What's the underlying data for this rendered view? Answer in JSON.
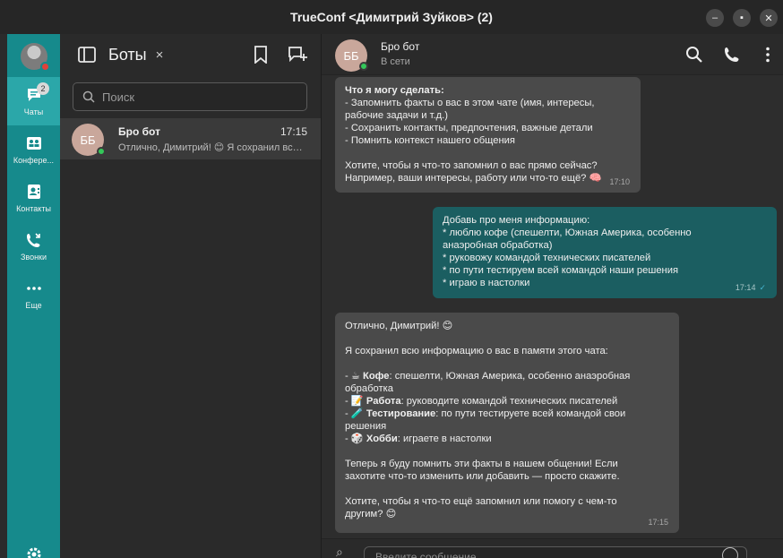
{
  "window": {
    "title": "TrueConf <Димитрий Зуйков> (2)",
    "minimize": "–",
    "maximize": "▪",
    "close": "✕"
  },
  "rail": {
    "chats": {
      "label": "Чаты",
      "badge": "2"
    },
    "conferences": {
      "label": "Конфере..."
    },
    "contacts": {
      "label": "Контакты"
    },
    "calls": {
      "label": "Звонки"
    },
    "more": {
      "label": "Еще"
    }
  },
  "list": {
    "title": "Боты",
    "close": "×",
    "search_placeholder": "Поиск",
    "chats": [
      {
        "initials": "ББ",
        "name": "Бро бот",
        "time": "17:15",
        "preview": "Отлично, Димитрий! 😊 Я сохранил всю информацию"
      }
    ]
  },
  "convo": {
    "initials": "ББ",
    "name": "Бро бот",
    "status": "В сети",
    "composer_placeholder": "Введите сообщение",
    "messages": [
      {
        "lines": [
          "**Что я могу сделать:**",
          "- Запомнить факты о вас в этом чате (имя, интересы,",
          "рабочие задачи и т.д.)",
          "- Сохранить контакты, предпочтения, важные детали",
          "- Помнить контекст нашего общения",
          "",
          "Хотите, чтобы я что-то запомнил о вас прямо сейчас?",
          "Например, ваши интересы, работу или что-то ещё? 🧠"
        ],
        "time": "17:10"
      },
      {
        "lines": [
          "Добавь про меня информацию:",
          "* люблю кофе (спешелти, Южная Америка, особенно",
          "анаэробная обработка)",
          "* руковожу командой технических писателей",
          "* по пути тестируем всей командой наши решения",
          "* играю в настолки"
        ],
        "time": "17:14",
        "tick": "✓"
      },
      {
        "lines": [
          "Отлично, Димитрий! 😊",
          "",
          "Я сохранил всю информацию о вас в памяти этого чата:",
          "",
          "- ☕ **Кофе**: спешелти, Южная Америка, особенно анаэробная",
          "обработка",
          "- 📝 **Работа**: руководите командой технических писателей",
          "- 🧪 **Тестирование**: по пути тестируете всей командой свои",
          "решения",
          "- 🎲 **Хобби**: играете в настолки",
          "",
          "Теперь я буду помнить эти факты в нашем общении! Если",
          "захотите что-то изменить или добавить — просто скажите.",
          "",
          "Хотите, чтобы я что-то ещё запомнил или помогу с чем-то",
          "другим? 😊"
        ],
        "time": "17:15"
      }
    ]
  }
}
